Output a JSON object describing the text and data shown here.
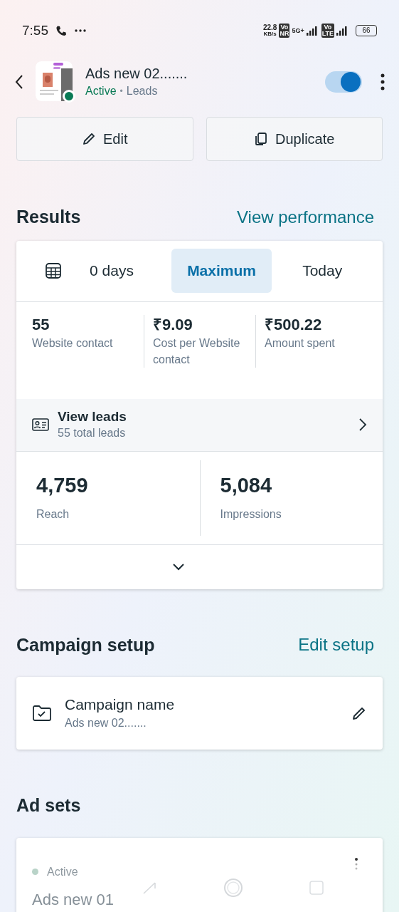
{
  "status_bar": {
    "time": "7:55",
    "speed_value": "22.8",
    "speed_unit": "KB/s",
    "badges": [
      {
        "top": "Vo",
        "bottom": "NR"
      },
      {
        "top": "Vo",
        "bottom": "LTE"
      }
    ],
    "network": "5G+",
    "battery": "66"
  },
  "header": {
    "title": "Ads new 02.......",
    "status": "Active",
    "separator": "•",
    "objective": "Leads",
    "on": true
  },
  "actions": [
    {
      "kind": "edit",
      "label": "Edit"
    },
    {
      "kind": "duplicate",
      "label": "Duplicate"
    }
  ],
  "results": {
    "title": "Results",
    "link": "View performance",
    "tabs": [
      {
        "label": "0 days",
        "selected": false
      },
      {
        "label": "Maximum",
        "selected": true
      },
      {
        "label": "Today",
        "selected": false
      }
    ],
    "metrics": [
      {
        "value": "55",
        "label": "Website contact"
      },
      {
        "value": "₹9.09",
        "label": "Cost per Website contact"
      },
      {
        "value": "₹500.22",
        "label": "Amount spent"
      }
    ],
    "leads": {
      "title": "View leads",
      "subtitle": "55 total leads"
    },
    "stats": [
      {
        "value": "4,759",
        "label": "Reach"
      },
      {
        "value": "5,084",
        "label": "Impressions"
      }
    ]
  },
  "campaign_setup": {
    "title": "Campaign setup",
    "link": "Edit setup",
    "item": {
      "label": "Campaign name",
      "value": "Ads new 02......."
    }
  },
  "ad_sets": {
    "title": "Ad sets",
    "item": {
      "status": "Active",
      "name": "Ads new 01"
    }
  }
}
